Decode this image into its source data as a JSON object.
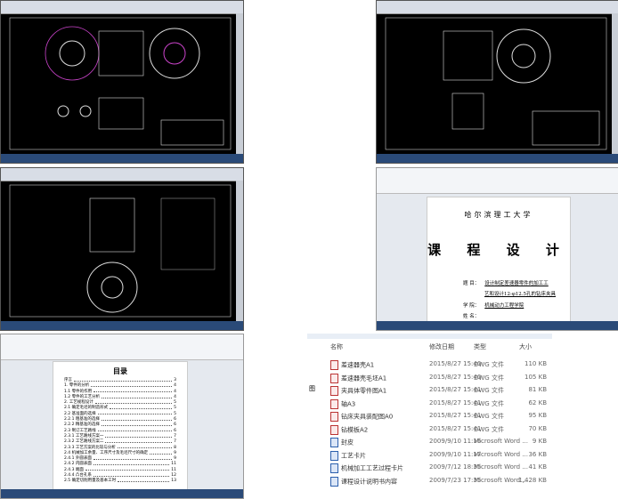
{
  "cover": {
    "university": "哈尔滨理工大学",
    "title": "课 程 设 计",
    "rows": [
      {
        "label": "题  目：",
        "value": "设计制定差速器零件的加工工"
      },
      {
        "label": "",
        "value": "艺和设计12-φ12.5孔的钻床夹具"
      },
      {
        "label": "学  院：",
        "value": "机械动力工程学院"
      },
      {
        "label": "姓  名：",
        "value": ""
      }
    ]
  },
  "toc": {
    "title": "目录",
    "entries": [
      {
        "t": "序言",
        "p": "3"
      },
      {
        "t": "1. 零件的分析",
        "p": "4"
      },
      {
        "t": "1.1 零件的作用",
        "p": "4"
      },
      {
        "t": "1.2 零件的工艺分析",
        "p": "4"
      },
      {
        "t": "2. 工艺规程设计",
        "p": "5"
      },
      {
        "t": "2.1 确定毛坯的制造形式",
        "p": "5"
      },
      {
        "t": "2.2 基准面的选择",
        "p": "5"
      },
      {
        "t": "2.2.1 粗基准的选择",
        "p": "6"
      },
      {
        "t": "2.2.2 精基准的选择",
        "p": "6"
      },
      {
        "t": "2.3 制订工艺路线",
        "p": "6"
      },
      {
        "t": "2.3.1 工艺路线方案一",
        "p": "7"
      },
      {
        "t": "2.3.2 工艺路线方案二",
        "p": "7"
      },
      {
        "t": "2.3.3 工艺方案的比较与分析",
        "p": "8"
      },
      {
        "t": "2.4 机械加工余量、工序尺寸及毛坯尺寸的确定",
        "p": "9"
      },
      {
        "t": "2.4.1 外圆表面",
        "p": "9"
      },
      {
        "t": "2.4.2 内圆表面",
        "p": "11"
      },
      {
        "t": "2.4.3 端面",
        "p": "11"
      },
      {
        "t": "2.4.4 凸台孔系",
        "p": "12"
      },
      {
        "t": "2.5 确定切削用量及基本工时",
        "p": "13"
      }
    ]
  },
  "files": {
    "headers": {
      "name": "名称",
      "date": "修改日期",
      "type": "类型",
      "size": "大小"
    },
    "side_label": "图",
    "rows": [
      {
        "name": "差速器壳A1",
        "date": "2015/8/27 15:40",
        "type": "DWG 文件",
        "size": "110 KB",
        "kind": "dwg"
      },
      {
        "name": "差速器壳毛坯A1",
        "date": "2015/8/27 15:40",
        "type": "DWG 文件",
        "size": "105 KB",
        "kind": "dwg"
      },
      {
        "name": "夹具体零件图A1",
        "date": "2015/8/27 15:41",
        "type": "DWG 文件",
        "size": "81 KB",
        "kind": "dwg"
      },
      {
        "name": "轴A3",
        "date": "2015/8/27 15:41",
        "type": "DWG 文件",
        "size": "62 KB",
        "kind": "dwg"
      },
      {
        "name": "钻床夹具装配图A0",
        "date": "2015/8/27 15:41",
        "type": "DWG 文件",
        "size": "95 KB",
        "kind": "dwg"
      },
      {
        "name": "钻模板A2",
        "date": "2015/8/27 15:41",
        "type": "DWG 文件",
        "size": "70 KB",
        "kind": "dwg"
      },
      {
        "name": "封皮",
        "date": "2009/9/10 11:16",
        "type": "Microsoft Word ...",
        "size": "9 KB",
        "kind": "doc"
      },
      {
        "name": "工艺卡片",
        "date": "2009/9/10 11:17",
        "type": "Microsoft Word ...",
        "size": "36 KB",
        "kind": "doc"
      },
      {
        "name": "机械加工工艺过程卡片",
        "date": "2009/7/12 18:35",
        "type": "Microsoft Word ...",
        "size": "41 KB",
        "kind": "doc"
      },
      {
        "name": "课程设计说明书内容",
        "date": "2009/7/23 17:35",
        "type": "Microsoft Word ...",
        "size": "1,428 KB",
        "kind": "doc"
      }
    ]
  }
}
